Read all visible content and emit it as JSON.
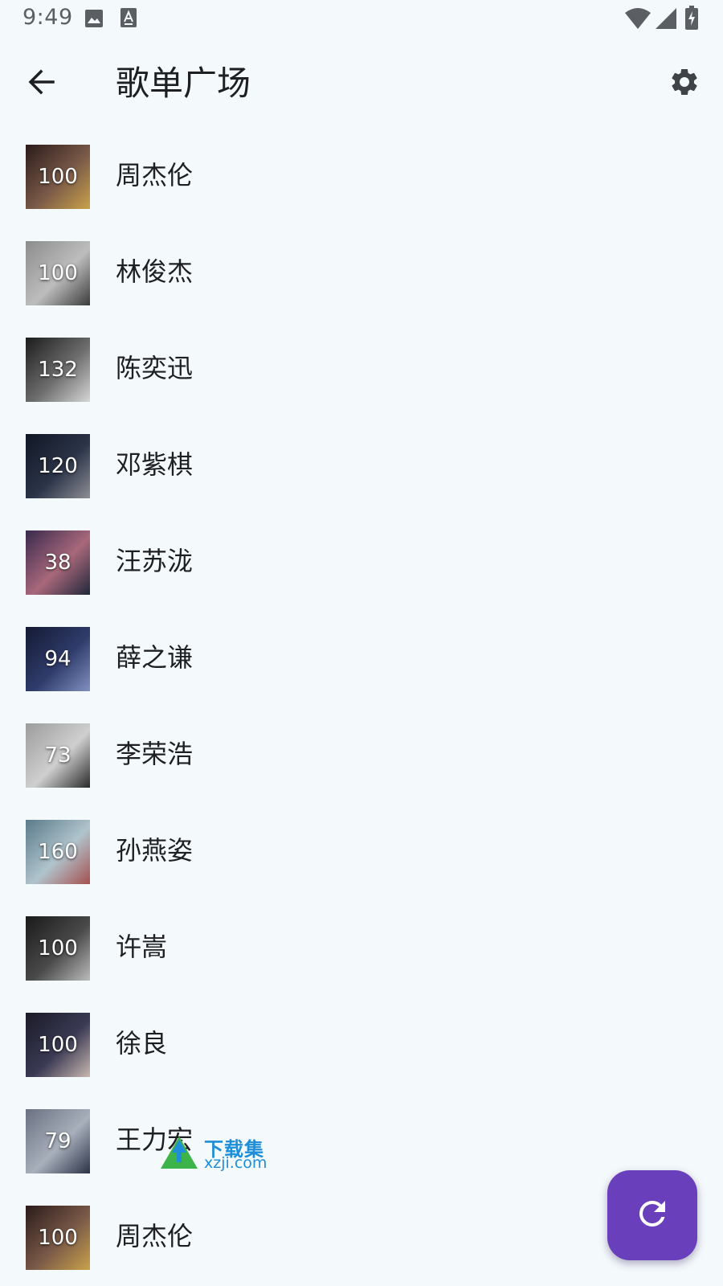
{
  "status_bar": {
    "time": "9:49",
    "icons": [
      "image-icon",
      "a-icon",
      "wifi-icon",
      "signal-icon",
      "battery-charging-icon"
    ]
  },
  "app_bar": {
    "title": "歌单广场",
    "back_icon": "arrow-back-icon",
    "settings_icon": "gear-icon"
  },
  "playlists": [
    {
      "name": "周杰伦",
      "count": "100",
      "colors": [
        "#2a1b1b",
        "#7a5a48",
        "#c9a24a"
      ]
    },
    {
      "name": "林俊杰",
      "count": "100",
      "colors": [
        "#8c8c8c",
        "#bdbdbd",
        "#3b3b3b"
      ]
    },
    {
      "name": "陈奕迅",
      "count": "132",
      "colors": [
        "#1c1c1c",
        "#6d6d6d",
        "#d6d6d6"
      ]
    },
    {
      "name": "邓紫棋",
      "count": "120",
      "colors": [
        "#101624",
        "#2b3448",
        "#8e8e94"
      ]
    },
    {
      "name": "汪苏泷",
      "count": "38",
      "colors": [
        "#3a2a4e",
        "#a8687a",
        "#20273a"
      ]
    },
    {
      "name": "薛之谦",
      "count": "94",
      "colors": [
        "#141a33",
        "#2f3c6b",
        "#8090c0"
      ]
    },
    {
      "name": "李荣浩",
      "count": "73",
      "colors": [
        "#9c9c9c",
        "#cfcfcf",
        "#2a2a2a"
      ]
    },
    {
      "name": "孙燕姿",
      "count": "160",
      "colors": [
        "#5a7a8a",
        "#b0c4cc",
        "#a55050"
      ]
    },
    {
      "name": "许嵩",
      "count": "100",
      "colors": [
        "#1a1a1a",
        "#4a4a4a",
        "#bcbcbc"
      ]
    },
    {
      "name": "徐良",
      "count": "100",
      "colors": [
        "#1b1b28",
        "#3a3a54",
        "#c9b8b0"
      ]
    },
    {
      "name": "王力宏",
      "count": "79",
      "colors": [
        "#6a7080",
        "#a8b0bc",
        "#2a3246"
      ]
    },
    {
      "name": "周杰伦",
      "count": "100",
      "colors": [
        "#2a1b1b",
        "#7a5a48",
        "#c9a24a"
      ]
    }
  ],
  "fab": {
    "icon": "refresh-icon",
    "color": "#6a3fbc"
  },
  "watermark": {
    "title": "下载集",
    "url": "xzji.com"
  },
  "colors": {
    "background": "#f4f9fb",
    "text": "#1e1f22",
    "accent": "#6a3fbc"
  }
}
